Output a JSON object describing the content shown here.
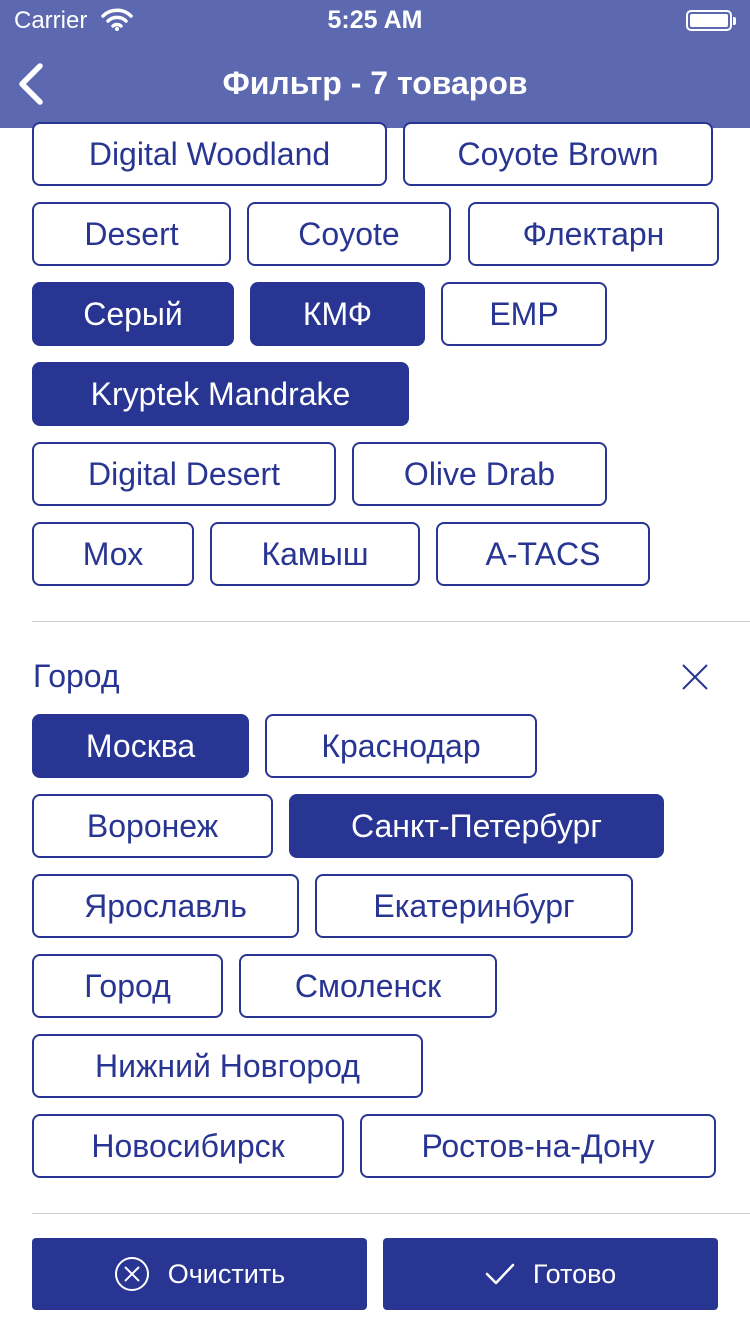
{
  "status_bar": {
    "carrier": "Carrier",
    "time": "5:25 AM"
  },
  "nav": {
    "title": "Фильтр - 7 товаров",
    "back_icon": "chevron-left-icon"
  },
  "camo": {
    "options": [
      {
        "label": "Digital Woodland",
        "selected": false
      },
      {
        "label": "Coyote Brown",
        "selected": false
      },
      {
        "label": "Desert",
        "selected": false
      },
      {
        "label": "Coyote",
        "selected": false
      },
      {
        "label": "Флектарн",
        "selected": false
      },
      {
        "label": "Серый",
        "selected": true
      },
      {
        "label": "КМФ",
        "selected": true
      },
      {
        "label": "EMP",
        "selected": false
      },
      {
        "label": "Kryptek Mandrake",
        "selected": true
      },
      {
        "label": "Digital Desert",
        "selected": false
      },
      {
        "label": "Olive Drab",
        "selected": false
      },
      {
        "label": "Мох",
        "selected": false
      },
      {
        "label": "Камыш",
        "selected": false
      },
      {
        "label": "A-TACS",
        "selected": false
      }
    ]
  },
  "city": {
    "title": "Город",
    "clear_icon": "close-icon",
    "options": [
      {
        "label": "Москва",
        "selected": true
      },
      {
        "label": "Краснодар",
        "selected": false
      },
      {
        "label": "Воронеж",
        "selected": false
      },
      {
        "label": "Санкт-Петербург",
        "selected": true
      },
      {
        "label": "Ярославль",
        "selected": false
      },
      {
        "label": "Екатеринбург",
        "selected": false
      },
      {
        "label": "Город",
        "selected": false
      },
      {
        "label": "Смоленск",
        "selected": false
      },
      {
        "label": "Нижний Новгород",
        "selected": false
      },
      {
        "label": "Новосибирск",
        "selected": false
      },
      {
        "label": "Ростов-на-Дону",
        "selected": false
      }
    ]
  },
  "actions": {
    "clear_label": "Очистить",
    "clear_icon": "circle-x-icon",
    "done_label": "Готово",
    "done_icon": "checkmark-icon"
  },
  "colors": {
    "accent": "#283593",
    "header": "#5c68b0",
    "divider": "#d0d0d0"
  }
}
